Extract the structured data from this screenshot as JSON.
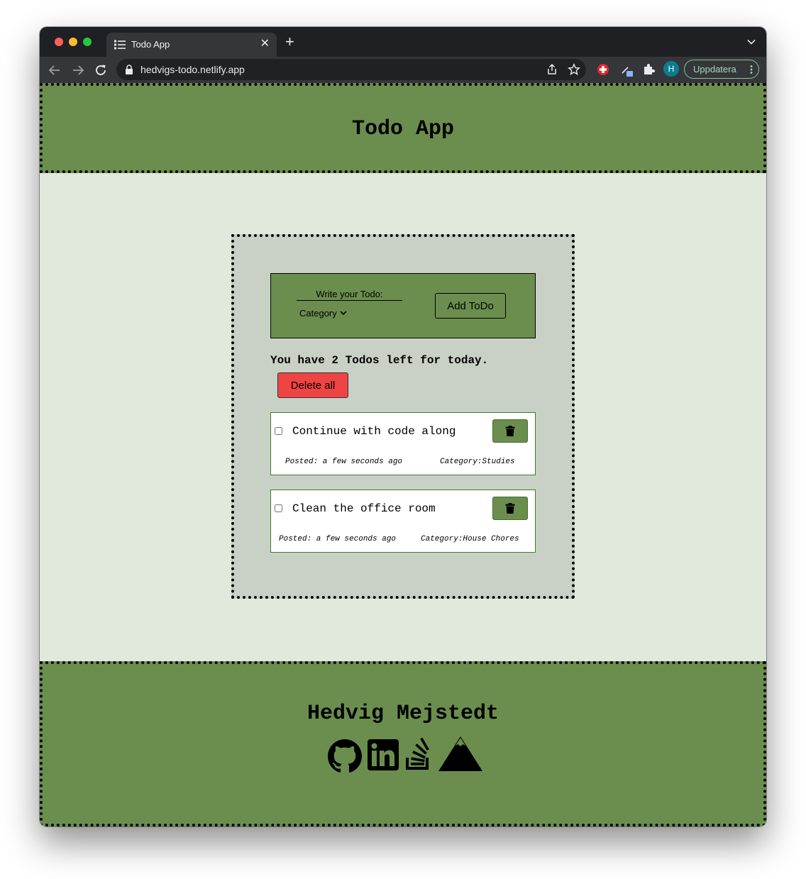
{
  "browser": {
    "tab_title": "Todo App",
    "url": "hedvigs-todo.netlify.app",
    "profile_initial": "H",
    "update_label": "Uppdatera"
  },
  "header": {
    "title": "Todo App"
  },
  "form": {
    "input_placeholder": "Write your Todo:",
    "category_label": "Category",
    "add_label": "Add ToDo"
  },
  "counter_text": "You have 2 Todos left for today.",
  "delete_all_label": "Delete all",
  "todos": [
    {
      "text": "Continue with code along",
      "checked": false,
      "posted": "Posted: a few seconds ago",
      "category": "Category:Studies"
    },
    {
      "text": "Clean the office room",
      "checked": false,
      "posted": "Posted: a few seconds ago",
      "category": "Category:House Chores"
    }
  ],
  "footer": {
    "name": "Hedvig Mejstedt",
    "icons": [
      "github-icon",
      "linkedin-icon",
      "stackoverflow-icon",
      "portfolio-mountain-icon"
    ]
  },
  "colors": {
    "green": "#6b8e4e",
    "page_bg": "#e1e9dd",
    "card_bg": "#c9d0c5",
    "danger": "#ef4444",
    "todo_border": "#3c7d2c"
  }
}
